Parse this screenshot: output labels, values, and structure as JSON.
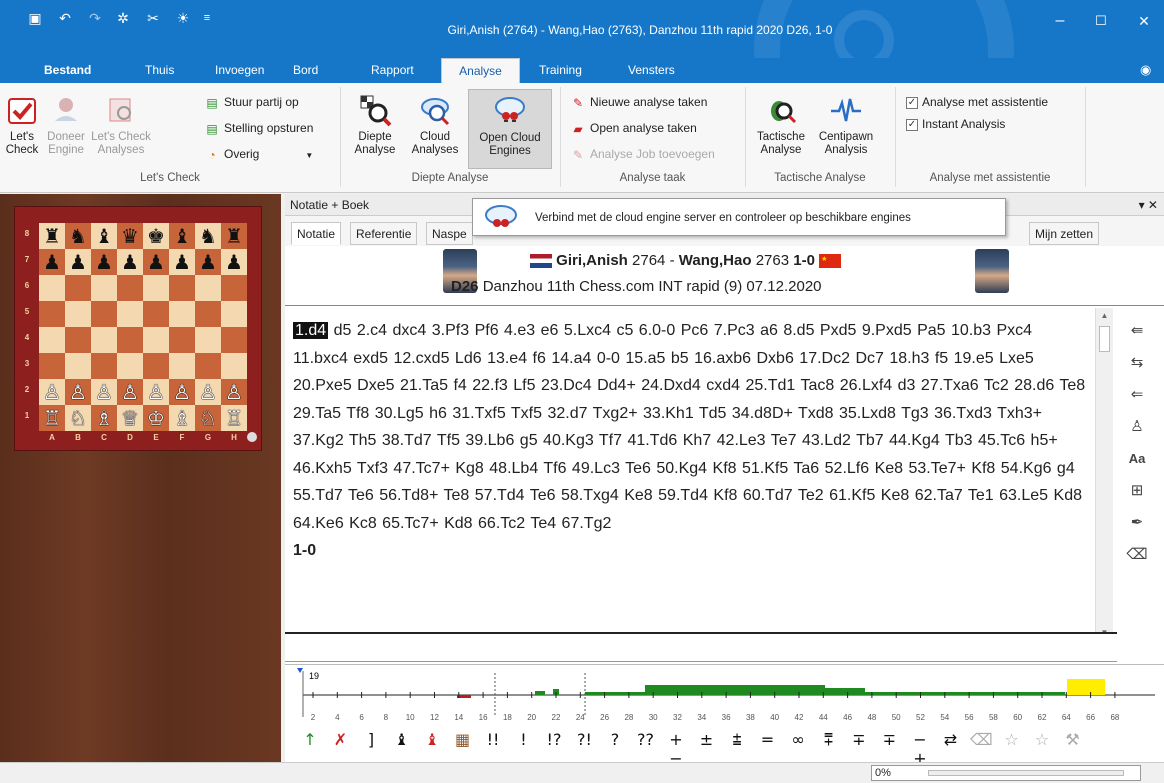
{
  "window": {
    "title": "Giri,Anish (2764) - Wang,Hao (2763), Danzhou 11th rapid 2020  D26, 1-0",
    "minimize": "–",
    "maximize": "☐",
    "close": "✕"
  },
  "ribbon_tabs": [
    "Bestand",
    "Thuis",
    "Invoegen",
    "Bord",
    "Rapport",
    "Analyse",
    "Training",
    "Vensters"
  ],
  "ribbon": {
    "letscheck": {
      "lets_check": "Let's Check",
      "doneer_engine": "Doneer Engine",
      "lets_check_analyses": "Let's Check Analyses",
      "stuur_partij": "Stuur partij op",
      "stelling_opsturen": "Stelling opsturen",
      "overig": "Overig",
      "group_label": "Let's Check"
    },
    "diepte": {
      "diepte_analyse": "Diepte Analyse",
      "cloud_analyses": "Cloud Analyses",
      "open_cloud_engines": "Open Cloud Engines",
      "group_label": "Diepte Analyse"
    },
    "taak": {
      "nieuwe": "Nieuwe analyse taken",
      "open": "Open analyse taken",
      "toevoegen": "Analyse Job toevoegen",
      "group_label": "Analyse taak"
    },
    "tactisch": {
      "tactische_analyse": "Tactische Analyse",
      "centipawn": "Centipawn Analysis",
      "group_label": "Tactische Analyse"
    },
    "assistentie": {
      "met_assistentie": "Analyse met assistentie",
      "instant": "Instant Analysis",
      "group_label": "Analyse met assistentie"
    }
  },
  "tooltip": "Verbind met de cloud engine server en controleer op beschikbare engines",
  "pane": {
    "title": "Notatie + Boek",
    "tabs": [
      "Notatie",
      "Referentie",
      "Naspe",
      "Mijn zetten"
    ]
  },
  "game": {
    "white": "Giri,Anish",
    "white_elo": "2764",
    "sep": "-",
    "black": "Wang,Hao",
    "black_elo": "2763",
    "result": "1-0",
    "eco": "D26",
    "event": "Danzhou 11th Chess.com INT rapid (9) 07.12.2020"
  },
  "notation": {
    "first_move": "1.d4",
    "moves": "d5 2.c4 dxc4 3.Pf3 Pf6 4.e3 e6 5.Lxc4 c5 6.0-0 Pc6 7.Pc3 a6 8.d5 Pxd5 9.Pxd5 Pa5 10.b3 Pxc4 11.bxc4 exd5 12.cxd5 Ld6 13.e4 f6 14.a4 0-0 15.a5 b5 16.axb6 Dxb6 17.Dc2 Dc7 18.h3 f5 19.e5 Lxe5 20.Pxe5 Dxe5 21.Ta5 f4 22.f3 Lf5 23.Dc4 Dd4+ 24.Dxd4 cxd4 25.Td1 Tac8 26.Lxf4 d3 27.Txa6 Tc2 28.d6 Te8 29.Ta5 Tf8 30.Lg5 h6 31.Txf5 Txf5 32.d7 Txg2+ 33.Kh1 Td5 34.d8D+ Txd8 35.Lxd8 Tg3 36.Txd3 Txh3+ 37.Kg2 Th5 38.Td7 Tf5 39.Lb6 g5 40.Kg3 Tf7 41.Td6 Kh7 42.Le3 Te7 43.Ld2 Tb7 44.Kg4 Tb3 45.Tc6 h5+ 46.Kxh5 Txf3 47.Tc7+ Kg8 48.Lb4 Tf6 49.Lc3 Te6 50.Kg4 Kf8 51.Kf5 Ta6 52.Lf6 Ke8 53.Te7+ Kf8 54.Kg6 g4 55.Td7 Te6 56.Td8+ Te8 57.Td4 Te6 58.Txg4 Ke8 59.Td4 Kf8 60.Td7 Te2 61.Kf5 Ke8 62.Ta7 Te1 63.Le5 Kd8 64.Ke6 Kc8 65.Tc7+ Kd8 66.Tc2 Te4 67.Tg2",
    "result": "1-0"
  },
  "board": {
    "ranks": [
      "8",
      "7",
      "6",
      "5",
      "4",
      "3",
      "2",
      "1"
    ],
    "files": [
      "A",
      "B",
      "C",
      "D",
      "E",
      "F",
      "G",
      "H"
    ],
    "rows": [
      [
        "♜",
        "♞",
        "♝",
        "♛",
        "♚",
        "♝",
        "♞",
        "♜"
      ],
      [
        "♟",
        "♟",
        "♟",
        "♟",
        "♟",
        "♟",
        "♟",
        "♟"
      ],
      [
        "",
        "",
        "",
        "",
        "",
        "",
        "",
        ""
      ],
      [
        "",
        "",
        "",
        "",
        "",
        "",
        "",
        ""
      ],
      [
        "",
        "",
        "",
        "",
        "",
        "",
        "",
        ""
      ],
      [
        "",
        "",
        "",
        "",
        "",
        "",
        "",
        ""
      ],
      [
        "♙",
        "♙",
        "♙",
        "♙",
        "♙",
        "♙",
        "♙",
        "♙"
      ],
      [
        "♖",
        "♘",
        "♗",
        "♕",
        "♔",
        "♗",
        "♘",
        "♖"
      ]
    ]
  },
  "evalgraph": {
    "move_label": "19",
    "axis": [
      "2",
      "4",
      "6",
      "8",
      "10",
      "12",
      "14",
      "16",
      "18",
      "20",
      "22",
      "24",
      "26",
      "28",
      "30",
      "32",
      "34",
      "36",
      "38",
      "40",
      "42",
      "44",
      "46",
      "48",
      "50",
      "52",
      "54",
      "56",
      "58",
      "60",
      "62",
      "64",
      "66",
      "68"
    ],
    "colors": {
      "white_adv": "#1f8a1f",
      "black_adv": "#c21a1a",
      "highlight": "#ffee00"
    }
  },
  "symbols": [
    "↑",
    "✗",
    "]",
    "♝",
    "♝",
    "▦",
    "!!",
    "!",
    "!?",
    "?!",
    "?",
    "??",
    "+−",
    "±",
    "⩲",
    "=",
    "∞",
    "⩱",
    "∓",
    "∓",
    "−+",
    "⇄",
    "⌫",
    "☆",
    "☆",
    "⚒"
  ],
  "status": {
    "progress": "0%"
  }
}
